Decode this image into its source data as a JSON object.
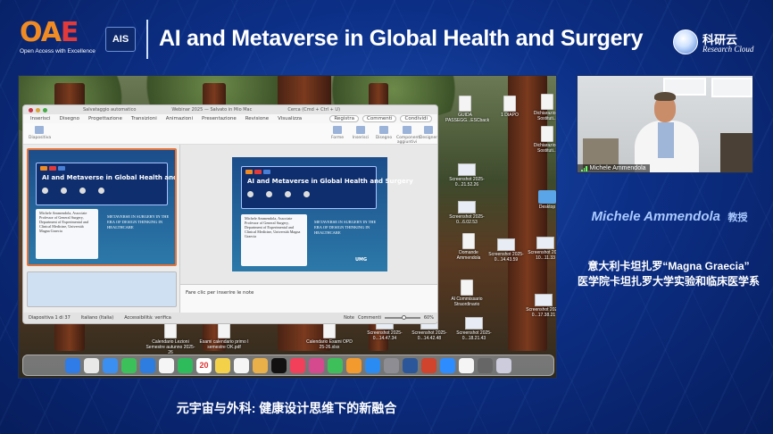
{
  "header": {
    "oae_mark": "OAE",
    "oae_tagline": "Open Access with Excellence",
    "ais_badge": "AIS",
    "title": "AI and Metaverse in Global Health and Surgery",
    "partner_cn": "科研云",
    "partner_en": "Research Cloud"
  },
  "shared_screen": {
    "ppt": {
      "autosave_label": "Salvataggio automatico",
      "window_title": "Webinar 2025 — Salvato in Mio Mac",
      "search_placeholder": "Cerca (Cmd + Ctrl + U)",
      "menu": [
        "Inserisci",
        "Disegno",
        "Progettazione",
        "Transizioni",
        "Animazioni",
        "Presentazione",
        "Revisione",
        "Visualizza"
      ],
      "record_btn": "Registra",
      "comments_btn": "Commenti",
      "share_btn": "Condividi",
      "ribbon": [
        "Diapositiva",
        "Forme",
        "Inserisci",
        "Disegno",
        "Componenti aggiuntivi",
        "Designer"
      ],
      "slide_title": "AI and Metaverse in Global Health and Surgery",
      "moderator_label": "Moderator",
      "speaker_label": "Speakers",
      "speaker_bio": "Michele Ammendola, Associate Professor of General Surgery, Department of Experimental and Clinical Medicine, Università Magna Graecia",
      "slide_script": "METAVERSE IN SURGERY IN THE ERA OF DESIGN THINKING IN HEALTHCARE",
      "slide_logo": "UMG",
      "notes_placeholder": "Fare clic per inserire le note",
      "status_slide": "Diapositiva 1 di 37",
      "status_lang": "Italiano (Italia)",
      "status_access": "Accessibilità: verifica",
      "status_notes": "Note",
      "status_comments": "Commenti",
      "zoom_pct": "60%",
      "zoom_fraction": 0.55
    },
    "desktop_icons": [
      "GUIDA PASSEGG...ESCback",
      "1 DIAPO",
      "Dichiarazione Sostituti...",
      "Dichiarazione Sostituti...",
      "Screenshot 2025-0...21.52.26",
      "Screenshot 2025-0...6.02.53",
      "Desktop",
      "Domande Ammendola",
      "Screenshot 2025-0...14.43.59",
      "Screenshot 2024-10...11.33",
      "Al Commissario Straordinario",
      "Screenshot 2025-0...17.38.21",
      "Calendario Lezioni Semestre autunno 2025-26",
      "Esami calendario primo I semestre OK.pdf",
      "Calendario Esami OPD 25-26.xlsx",
      "Screenshot 2025-0...14.47.34",
      "Screenshot 2025-0...14.42.48",
      "Screenshot 2025-0...18.21.43"
    ],
    "dock_date": "20"
  },
  "speaker": {
    "video_name": "Michele Ammendola",
    "name": "Michele Ammendola",
    "role": "教授",
    "affiliation_line1": "意大利卡坦扎罗“Magna Graecia”",
    "affiliation_line2": "医学院卡坦扎罗大学实验和临床医学系"
  },
  "subtitle": "元宇宙与外科: 健康设计思维下的新融合",
  "colors": {
    "background": "#0c2f86",
    "accent_orange": "#f08a23",
    "accent_red": "#e23a3a",
    "speaker_name": "#a9c9ff"
  },
  "icons": [
    "oae-logo",
    "research-cloud-logo",
    "signal-icon",
    "dock-app-icons"
  ]
}
